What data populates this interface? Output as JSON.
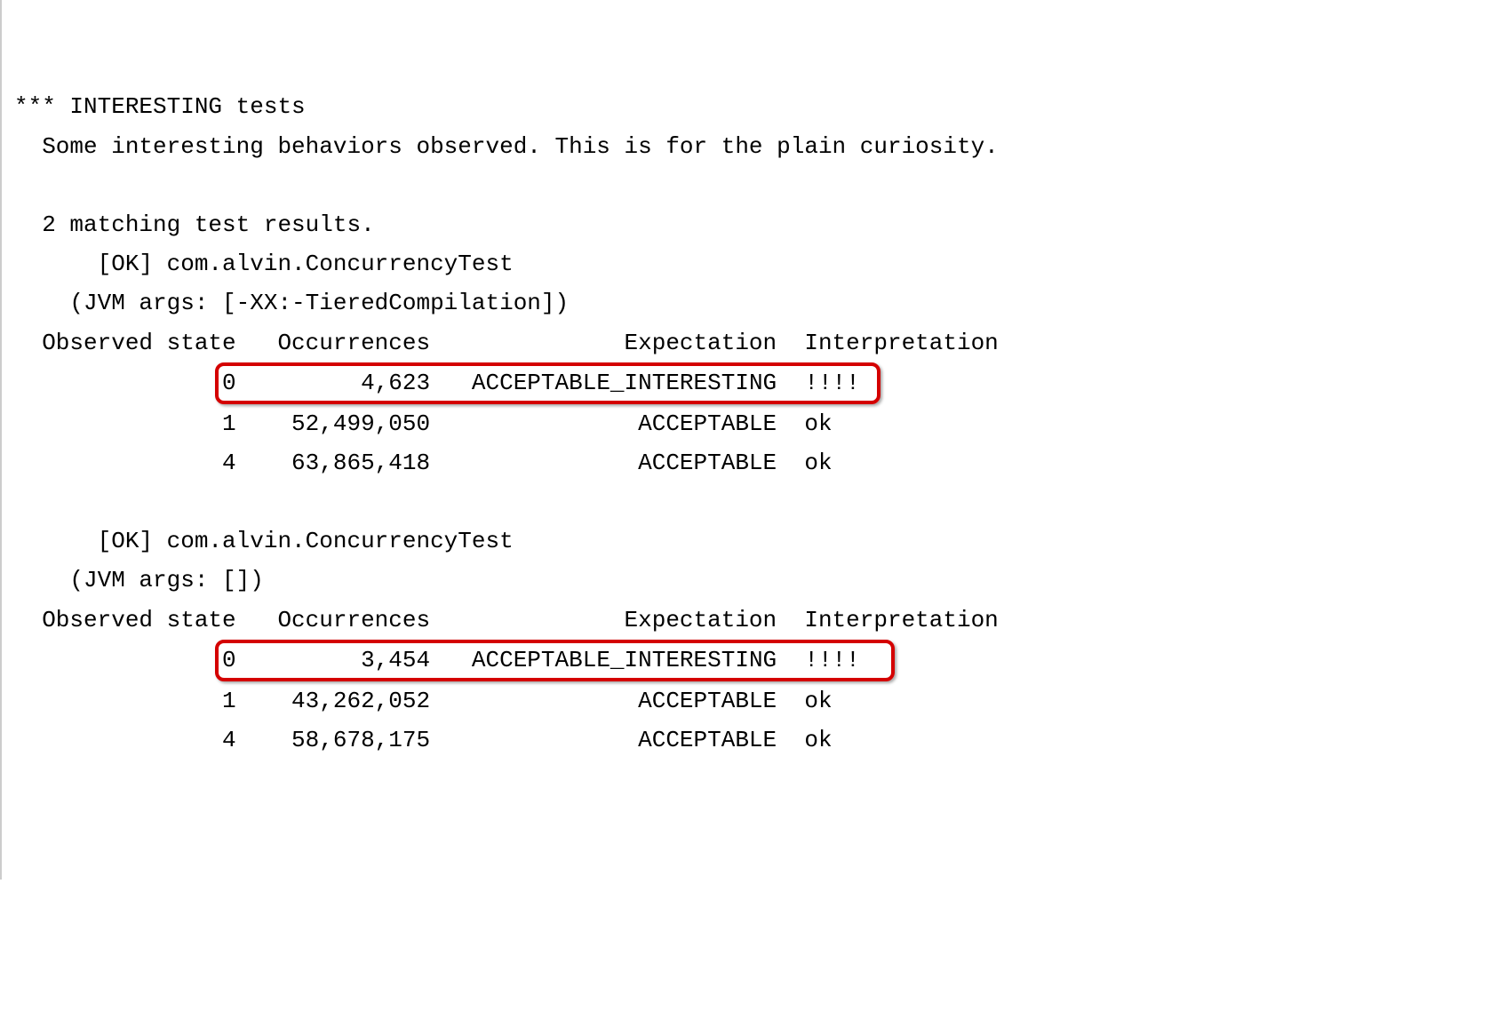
{
  "header": "*** INTERESTING tests",
  "description": "  Some interesting behaviors observed. This is for the plain curiosity.",
  "matching_count": "  2 matching test results.",
  "tests": [
    {
      "title": "      [OK] com.alvin.ConcurrencyTest",
      "jvm_args": "    (JVM args: [-XX:-TieredCompilation])",
      "header_row": "  Observed state   Occurrences              Expectation  Interpretation",
      "rows": [
        {
          "pad": "               ",
          "body": "0         4,623   ACCEPTABLE_INTERESTING  !!!! ",
          "highlighted": true,
          "state": "0",
          "occurrences": "4,623",
          "expectation": "ACCEPTABLE_INTERESTING",
          "interpretation": "!!!!"
        },
        {
          "full": "               1    52,499,050               ACCEPTABLE  ok",
          "highlighted": false,
          "state": "1",
          "occurrences": "52,499,050",
          "expectation": "ACCEPTABLE",
          "interpretation": "ok"
        },
        {
          "full": "               4    63,865,418               ACCEPTABLE  ok",
          "highlighted": false,
          "state": "4",
          "occurrences": "63,865,418",
          "expectation": "ACCEPTABLE",
          "interpretation": "ok"
        }
      ]
    },
    {
      "title": "      [OK] com.alvin.ConcurrencyTest",
      "jvm_args": "    (JVM args: [])",
      "header_row": "  Observed state   Occurrences              Expectation  Interpretation",
      "rows": [
        {
          "pad": "               ",
          "body": "0         3,454   ACCEPTABLE_INTERESTING  !!!!  ",
          "highlighted": true,
          "state": "0",
          "occurrences": "3,454",
          "expectation": "ACCEPTABLE_INTERESTING",
          "interpretation": "!!!!"
        },
        {
          "full": "               1    43,262,052               ACCEPTABLE  ok",
          "highlighted": false,
          "state": "1",
          "occurrences": "43,262,052",
          "expectation": "ACCEPTABLE",
          "interpretation": "ok"
        },
        {
          "full": "               4    58,678,175               ACCEPTABLE  ok",
          "highlighted": false,
          "state": "4",
          "occurrences": "58,678,175",
          "expectation": "ACCEPTABLE",
          "interpretation": "ok"
        }
      ]
    }
  ]
}
